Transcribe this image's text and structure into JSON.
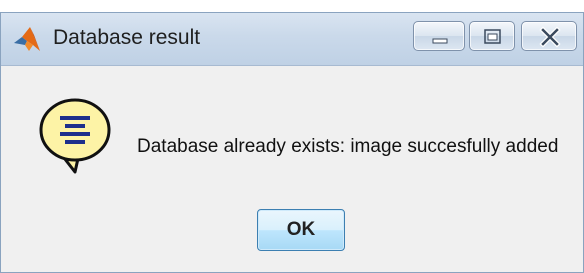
{
  "window": {
    "title": "Database result",
    "app_icon": "matlab-logo-icon",
    "controls": {
      "minimize_icon": "minimize-icon",
      "maximize_icon": "maximize-icon",
      "close_icon": "close-icon"
    }
  },
  "dialog": {
    "icon": "help-speech-bubble-icon",
    "message": "Database already exists: image succesfully added",
    "ok_label": "OK"
  },
  "colors": {
    "titlebar": "#cad9ea",
    "body": "#f0f0f0",
    "ok_button": "#bee6fd",
    "icon_fill": "#fdf3a6",
    "icon_lines": "#1d2f8c"
  }
}
